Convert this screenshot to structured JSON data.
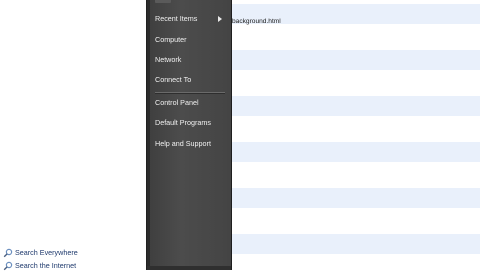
{
  "start_menu": {
    "right_items": [
      {
        "label": "Recent Items",
        "has_submenu": true
      },
      {
        "label": "Computer",
        "has_submenu": false
      },
      {
        "label": "Network",
        "has_submenu": false
      },
      {
        "label": "Connect To",
        "has_submenu": false
      },
      {
        "label": "Control Panel",
        "has_submenu": false
      },
      {
        "label": "Default Programs",
        "has_submenu": false
      },
      {
        "label": "Help and Support",
        "has_submenu": false
      }
    ],
    "search_links": [
      {
        "label": "Search Everywhere",
        "icon": "magnifier-icon"
      },
      {
        "label": "Search the Internet",
        "icon": "magnifier-icon"
      }
    ]
  },
  "background_window": {
    "visible_file": "background.html"
  },
  "colors": {
    "menu_dark": "#444444",
    "menu_text": "#f2f2f2",
    "stripe": "#e9f0fb",
    "link_text": "#1f3a6d"
  }
}
